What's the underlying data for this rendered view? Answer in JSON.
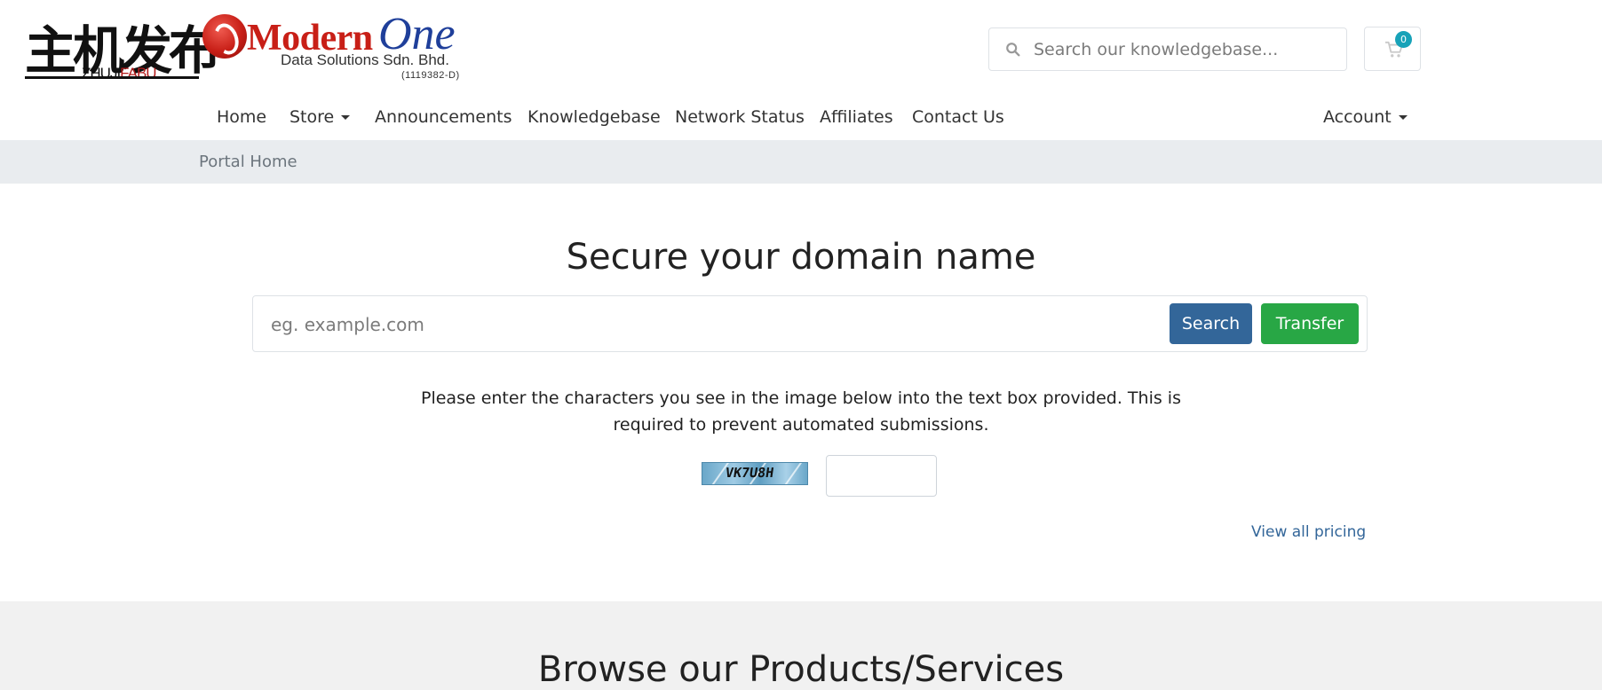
{
  "logo": {
    "cn": "主机发布",
    "cn_sub_a": "ZHUJI",
    "cn_sub_b": "FABU",
    "modern": "Modern",
    "one": "One",
    "subtitle": "Data Solutions Sdn. Bhd.",
    "reg": "(1119382-D)"
  },
  "header": {
    "search_placeholder": "Search our knowledgebase...",
    "cart_count": "0"
  },
  "nav": {
    "items": [
      {
        "label": "Home"
      },
      {
        "label": "Store"
      },
      {
        "label": "Announcements"
      },
      {
        "label": "Knowledgebase"
      },
      {
        "label": "Network Status"
      },
      {
        "label": "Affiliates"
      },
      {
        "label": "Contact Us"
      }
    ],
    "account": "Account"
  },
  "breadcrumb": {
    "current": "Portal Home"
  },
  "domain": {
    "title": "Secure your domain name",
    "placeholder": "eg. example.com",
    "search_label": "Search",
    "transfer_label": "Transfer",
    "captcha_line1": "Please enter the characters you see in the image below into the text box provided. This is",
    "captcha_line2": "required to prevent automated submissions.",
    "captcha_code": "VK7U8H",
    "view_pricing": "View all pricing"
  },
  "browse": {
    "title": "Browse our Products/Services"
  },
  "colors": {
    "primary": "#336699",
    "success": "#28a745",
    "badge": "#17a2b8",
    "breadcrumb_bg": "#e9ecef"
  }
}
